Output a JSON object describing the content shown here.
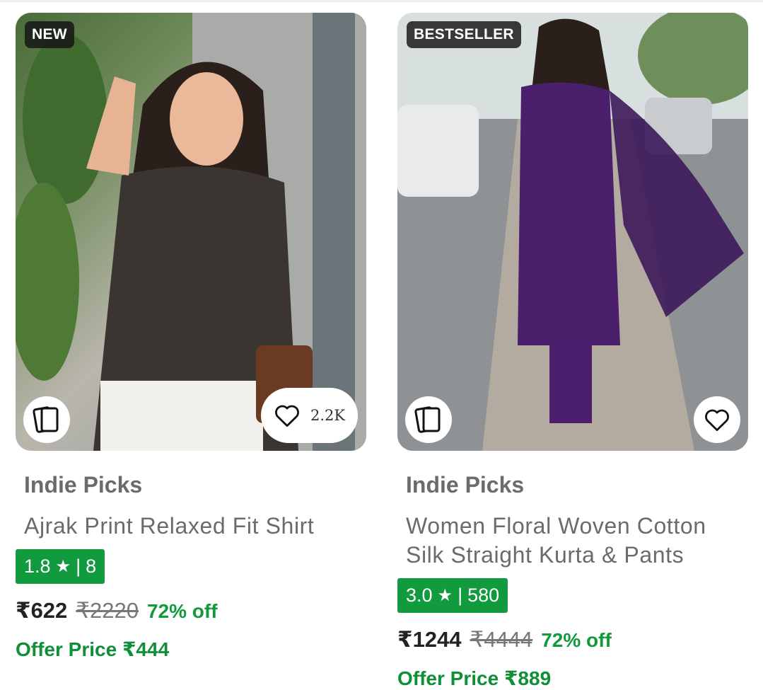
{
  "products": [
    {
      "badge": "NEW",
      "brand": "Indie Picks",
      "name": "Ajrak Print Relaxed Fit Shirt",
      "rating": "1.8",
      "rating_count": "8",
      "price": "₹622",
      "mrp": "₹2220",
      "discount": "72% off",
      "offer": "Offer Price ₹444",
      "wishlist_count": "2.2K",
      "image_alt": "Woman in Ajrak print shirt waving"
    },
    {
      "badge": "BESTSELLER",
      "brand": "Indie Picks",
      "name": "Women Floral Woven Cotton Silk Straight Kurta & Pants",
      "rating": "3.0",
      "rating_count": "580",
      "price": "₹1244",
      "mrp": "₹4444",
      "discount": "72% off",
      "offer": "Offer Price ₹889",
      "image_alt": "Woman in purple kurta set walking on street"
    }
  ],
  "colors": {
    "rating_bg": "#129b3e",
    "discount": "#119a3c",
    "offer": "#0f8f37"
  },
  "icons": [
    "collections-icon",
    "heart-icon"
  ]
}
